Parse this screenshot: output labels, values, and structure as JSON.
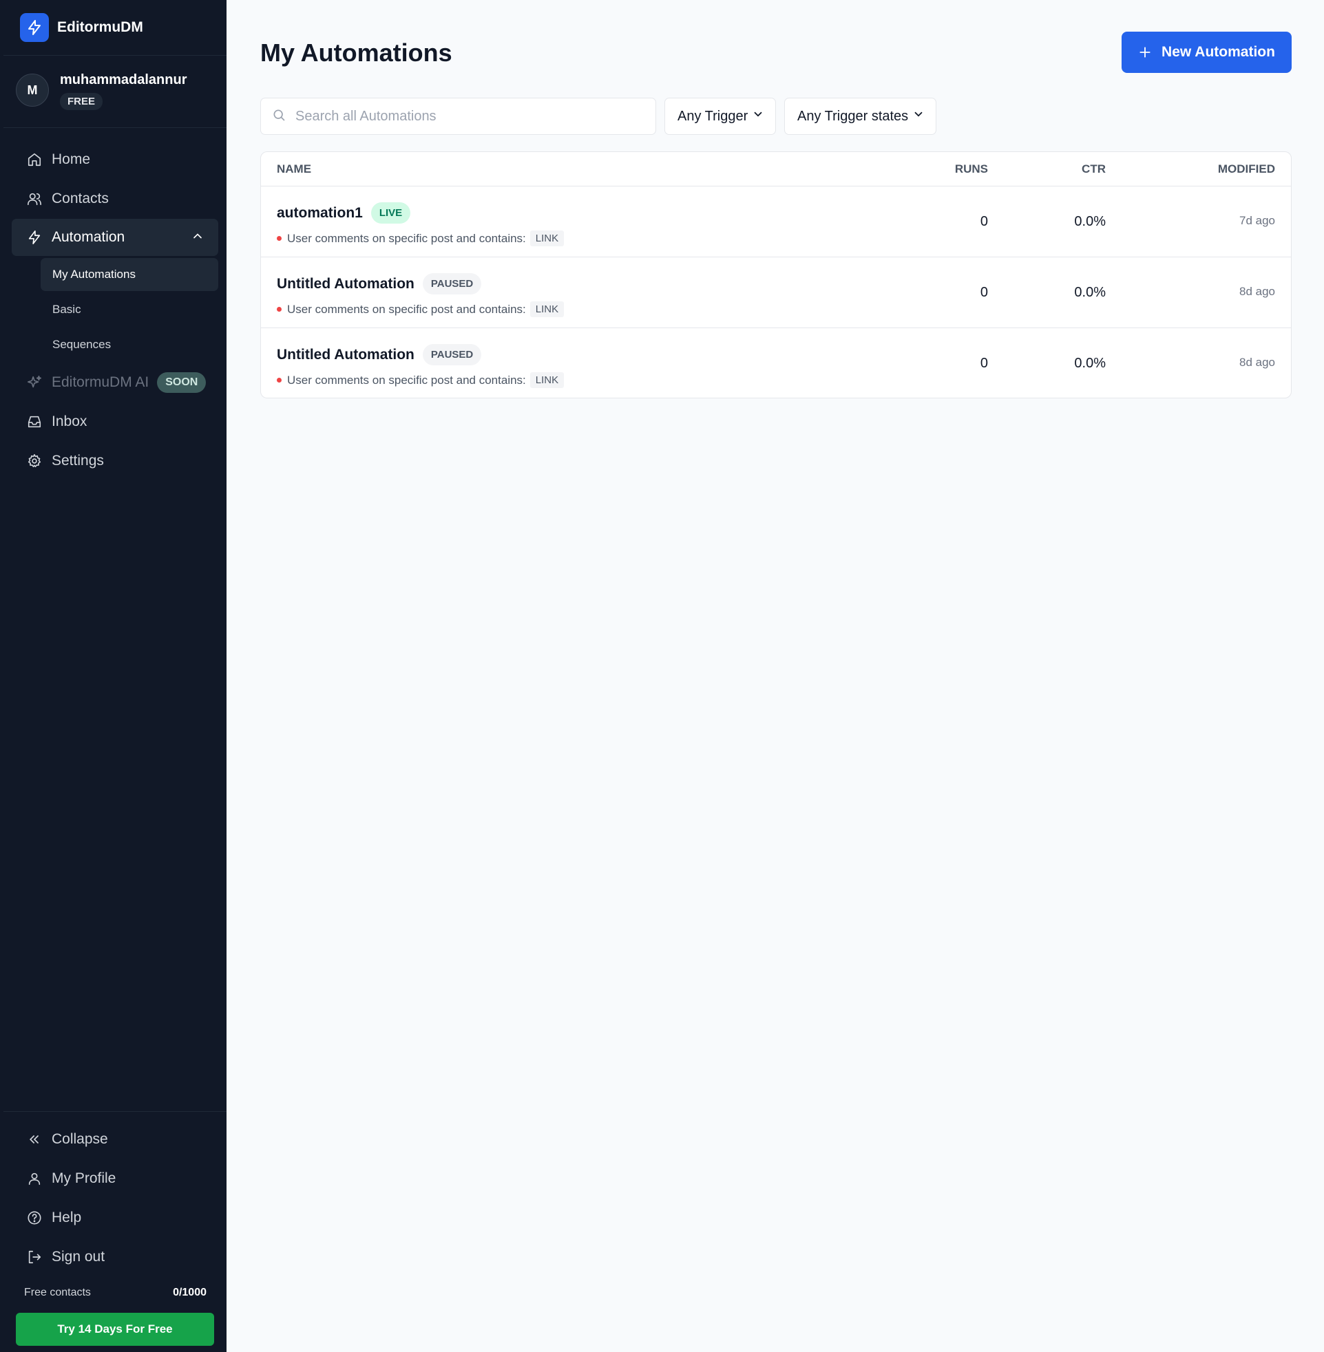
{
  "sidebar": {
    "brand": "EditormuDM",
    "user": {
      "initial": "M",
      "name": "muhammadalannur",
      "plan": "FREE"
    },
    "nav": {
      "home": "Home",
      "contacts": "Contacts",
      "automation": "Automation",
      "ai": "EditormuDM AI",
      "ai_badge": "SOON",
      "inbox": "Inbox",
      "settings": "Settings"
    },
    "sub_nav": {
      "my_automations": "My Automations",
      "basic": "Basic",
      "sequences": "Sequences"
    },
    "bottom": {
      "collapse": "Collapse",
      "profile": "My Profile",
      "help": "Help",
      "signout": "Sign out"
    },
    "contacts_label": "Free contacts",
    "contacts_count": "0/1000",
    "trial_button": "Try 14 Days For Free"
  },
  "main": {
    "title": "My Automations",
    "new_button": "New Automation",
    "search_placeholder": "Search all Automations",
    "trigger_filter": "Any Trigger",
    "state_filter": "Any Trigger states",
    "columns": {
      "name": "NAME",
      "runs": "RUNS",
      "ctr": "CTR",
      "modified": "MODIFIED"
    },
    "rows": [
      {
        "name": "automation1",
        "status": "LIVE",
        "trigger": "User comments on specific post and contains:",
        "keyword": "LINK",
        "runs": "0",
        "ctr": "0.0%",
        "modified": "7d ago"
      },
      {
        "name": "Untitled Automation",
        "status": "PAUSED",
        "trigger": "User comments on specific post and contains:",
        "keyword": "LINK",
        "runs": "0",
        "ctr": "0.0%",
        "modified": "8d ago"
      },
      {
        "name": "Untitled Automation",
        "status": "PAUSED",
        "trigger": "User comments on specific post and contains:",
        "keyword": "LINK",
        "runs": "0",
        "ctr": "0.0%",
        "modified": "8d ago"
      }
    ]
  },
  "colors": {
    "accent": "#2563eb",
    "sidebar_bg": "#111827",
    "live": "#047857",
    "trial": "#16a34a",
    "trigger_dot": "#ef4444"
  }
}
